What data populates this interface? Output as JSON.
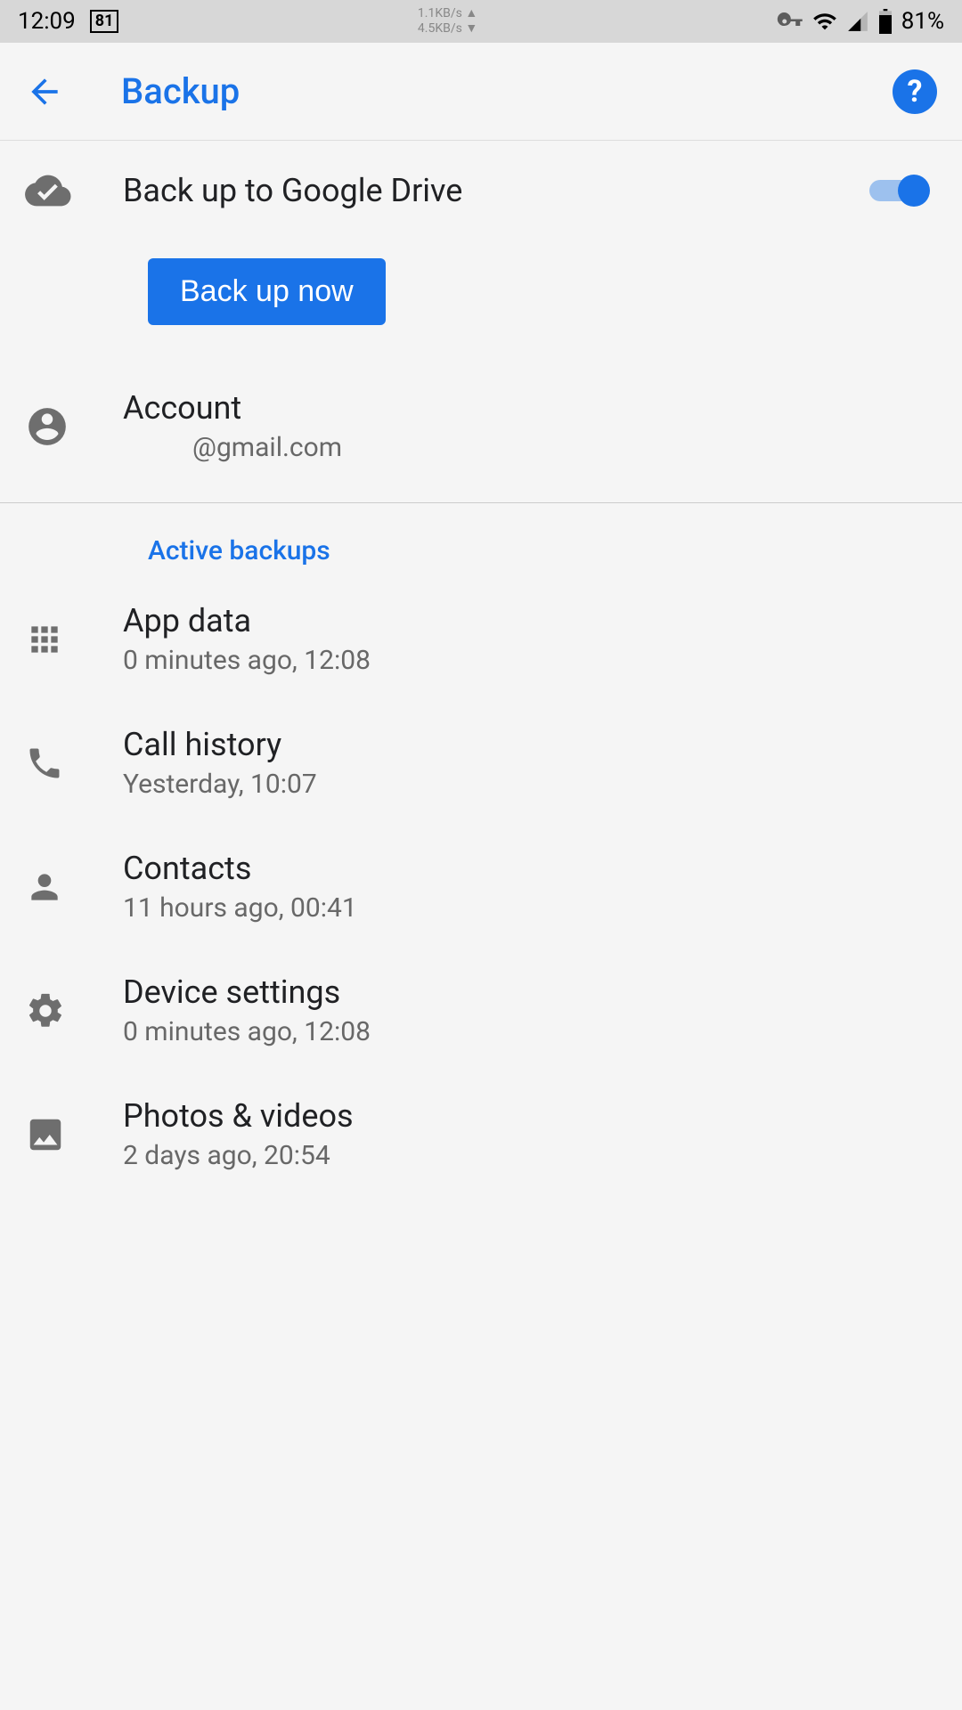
{
  "status": {
    "time": "12:09",
    "date_badge": "81",
    "net_up": "1.1KB/s ▲",
    "net_down": "4.5KB/s ▼",
    "battery": "81%"
  },
  "appbar": {
    "title": "Backup"
  },
  "backup_drive": {
    "title": "Back up to Google Drive",
    "enabled": true
  },
  "backup_now": {
    "label": "Back up now"
  },
  "account": {
    "title": "Account",
    "email": "@gmail.com"
  },
  "active_backups": {
    "header": "Active backups",
    "items": [
      {
        "icon": "apps",
        "title": "App data",
        "sub": "0 minutes ago, 12:08"
      },
      {
        "icon": "phone",
        "title": "Call history",
        "sub": "Yesterday, 10:07"
      },
      {
        "icon": "person",
        "title": "Contacts",
        "sub": "11 hours ago, 00:41"
      },
      {
        "icon": "gear",
        "title": "Device settings",
        "sub": "0 minutes ago, 12:08"
      },
      {
        "icon": "image",
        "title": "Photos & videos",
        "sub": "2 days ago, 20:54"
      }
    ]
  }
}
